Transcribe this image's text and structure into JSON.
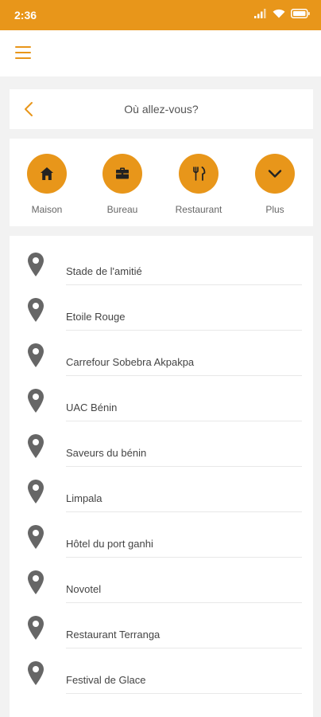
{
  "status_bar": {
    "time": "2:36",
    "battery_icon": "battery-icon",
    "wifi_icon": "wifi-icon",
    "signal_icon": "signal-icon"
  },
  "app_bar": {
    "menu_icon": "hamburger-menu-icon"
  },
  "search": {
    "title": "Où allez-vous?",
    "back_icon": "chevron-left-icon"
  },
  "shortcuts": [
    {
      "label": "Maison",
      "icon": "home-icon"
    },
    {
      "label": "Bureau",
      "icon": "briefcase-icon"
    },
    {
      "label": "Restaurant",
      "icon": "fork-knife-icon"
    },
    {
      "label": "Plus",
      "icon": "chevron-down-icon"
    }
  ],
  "places": [
    {
      "name": "Stade de l'amitié"
    },
    {
      "name": "Etoile Rouge"
    },
    {
      "name": "Carrefour Sobebra Akpakpa"
    },
    {
      "name": "UAC Bénin"
    },
    {
      "name": "Saveurs du bénin"
    },
    {
      "name": "Limpala"
    },
    {
      "name": "Hôtel du port ganhi"
    },
    {
      "name": "Novotel"
    },
    {
      "name": "Restaurant Terranga"
    },
    {
      "name": "Festival de Glace"
    }
  ],
  "colors": {
    "accent": "#e8961a",
    "pin": "#666666",
    "background": "#f2f2f2"
  }
}
